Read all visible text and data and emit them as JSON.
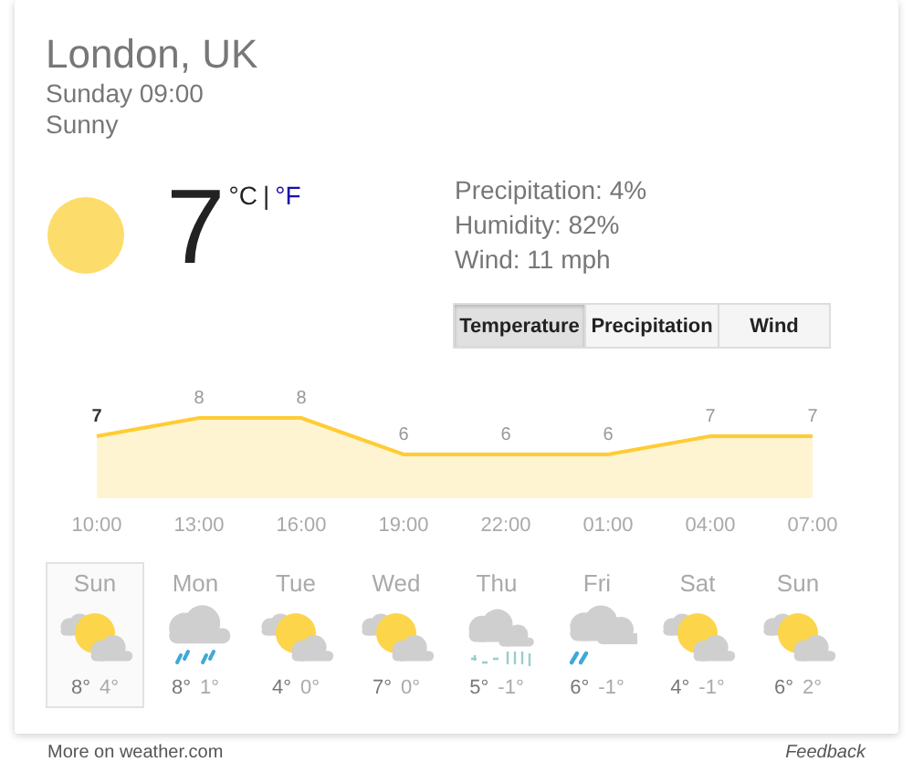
{
  "location": "London, UK",
  "datetime": "Sunday 09:00",
  "condition": "Sunny",
  "current": {
    "kind": "sun",
    "temperature": "7",
    "units": [
      {
        "label": "°C",
        "selected": true
      },
      {
        "label": "°F",
        "selected": false
      }
    ],
    "separator": "|"
  },
  "details": [
    "Precipitation: 4%",
    "Humidity: 82%",
    "Wind: 11 mph"
  ],
  "tabs": [
    {
      "label": "Temperature",
      "selected": true
    },
    {
      "label": "Precipitation",
      "selected": false
    },
    {
      "label": "Wind",
      "selected": false
    }
  ],
  "chart_data": {
    "type": "area",
    "categories": [
      "10:00",
      "13:00",
      "16:00",
      "19:00",
      "22:00",
      "01:00",
      "04:00",
      "07:00"
    ],
    "series": [
      {
        "color": "#ffcc33",
        "values": [
          7,
          8,
          8,
          6,
          6,
          6,
          7,
          7
        ]
      }
    ],
    "data_labels": true
  },
  "days": [
    {
      "day": "Sun",
      "kind": "partly",
      "high": "8°",
      "low": "4°",
      "selected": true
    },
    {
      "day": "Mon",
      "kind": "rain",
      "high": "8°",
      "low": "1°",
      "selected": false
    },
    {
      "day": "Tue",
      "kind": "partly",
      "high": "4°",
      "low": "0°",
      "selected": false
    },
    {
      "day": "Wed",
      "kind": "partly",
      "high": "7°",
      "low": "0°",
      "selected": false
    },
    {
      "day": "Thu",
      "kind": "sleet",
      "high": "5°",
      "low": "-1°",
      "selected": false
    },
    {
      "day": "Fri",
      "kind": "showers",
      "high": "6°",
      "low": "-1°",
      "selected": false
    },
    {
      "day": "Sat",
      "kind": "partly",
      "high": "4°",
      "low": "-1°",
      "selected": false
    },
    {
      "day": "Sun",
      "kind": "partly",
      "high": "6°",
      "low": "2°",
      "selected": false
    }
  ],
  "footer": {
    "link": "More on weather.com",
    "feedback": "Feedback"
  }
}
